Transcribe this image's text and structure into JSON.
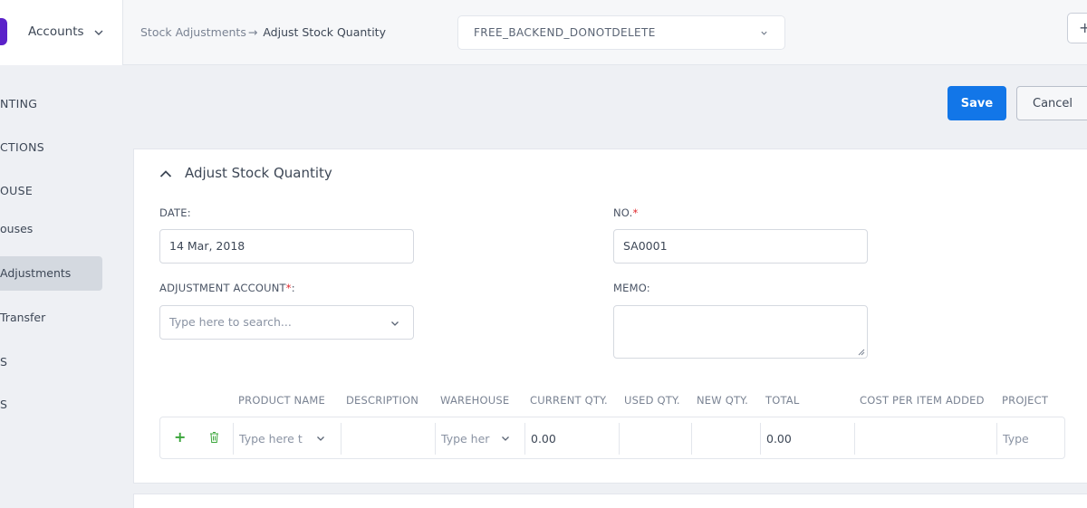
{
  "header": {
    "app_name": "Accounts",
    "breadcrumb": {
      "parent": "Stock Adjustments",
      "separator": "→",
      "current": "Adjust Stock Quantity"
    },
    "organization_select": {
      "value": "FREE_BACKEND_DONOTDELETE"
    },
    "add_button_label": "+"
  },
  "sidebar": {
    "items": [
      {
        "label": "NTING",
        "kind": "section"
      },
      {
        "label": "CTIONS",
        "kind": "section"
      },
      {
        "label": "OUSE",
        "kind": "section"
      },
      {
        "label": "ouses",
        "kind": "link"
      },
      {
        "label": "Adjustments",
        "kind": "link",
        "active": true
      },
      {
        "label": "Transfer",
        "kind": "link"
      },
      {
        "label": "S",
        "kind": "section"
      },
      {
        "label": "S",
        "kind": "section"
      }
    ]
  },
  "actions": {
    "save_label": "Save",
    "cancel_label": "Cancel"
  },
  "form": {
    "title": "Adjust Stock Quantity",
    "date": {
      "label": "DATE:",
      "value": "14 Mar, 2018"
    },
    "number": {
      "label": "NO.",
      "required_mark": "*",
      "value": "SA0001"
    },
    "adjustment_account": {
      "label": "ADJUSTMENT ACCOUNT",
      "required_mark": "*",
      "placeholder": "Type here to search..."
    },
    "memo": {
      "label": "MEMO:",
      "value": ""
    }
  },
  "table": {
    "columns": [
      "PRODUCT NAME",
      "DESCRIPTION",
      "WAREHOUSE",
      "CURRENT QTY.",
      "USED QTY.",
      "NEW QTY.",
      "TOTAL",
      "COST PER ITEM ADDED",
      "PROJECT"
    ],
    "row": {
      "product_placeholder": "Type here t",
      "description": "",
      "warehouse_placeholder": "Type her",
      "current_qty": "0.00",
      "used_qty": "",
      "new_qty": "",
      "total": "0.00",
      "cost_per_item": "",
      "project_placeholder": "Type"
    }
  },
  "colors": {
    "primary": "#1276e8",
    "brand": "#5b22c9",
    "required": "#e0292e",
    "add_row": "#3aa53a"
  }
}
